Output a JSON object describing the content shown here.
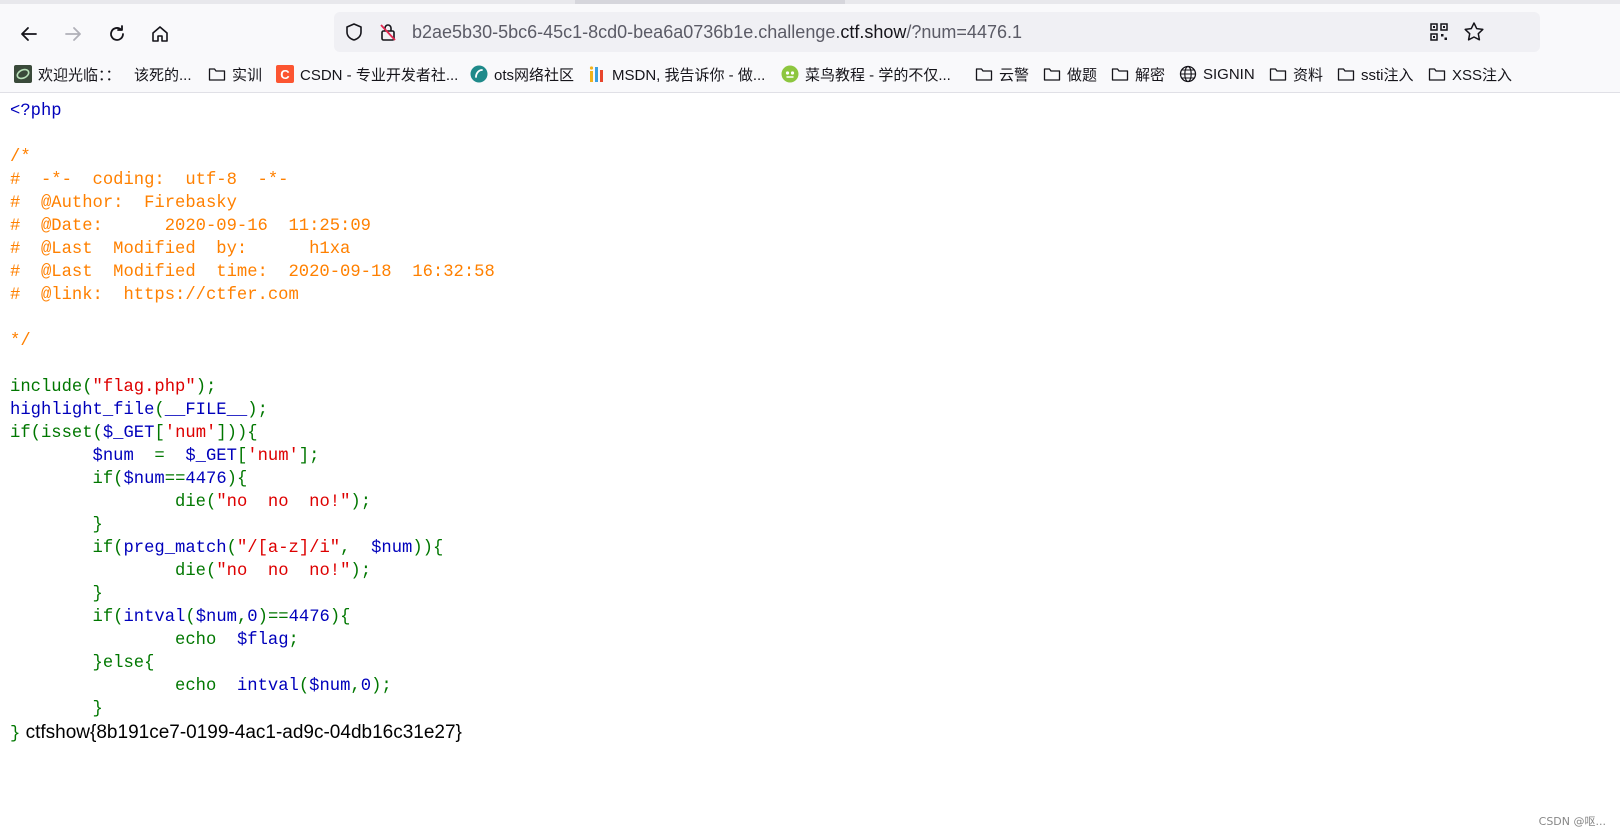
{
  "browser": {
    "url_prefix": "b2ae5b30-5bc6-45c1-8cd0-bea6a0736b1e.challenge.",
    "url_host": "ctf.show",
    "url_suffix": "/?num=4476.1"
  },
  "bookmarks": [
    {
      "icon": "swirl-icon",
      "label": "欢迎光临：："
    },
    {
      "icon": "none",
      "label": "该死的..."
    },
    {
      "icon": "folder-icon",
      "label": "实训"
    },
    {
      "icon": "csdn-icon",
      "label": "CSDN - 专业开发者社..."
    },
    {
      "icon": "ots-icon",
      "label": "ots网络社区"
    },
    {
      "icon": "msdn-icon",
      "label": "MSDN, 我告诉你 - 做..."
    },
    {
      "icon": "runoob-icon",
      "label": "菜鸟教程 - 学的不仅..."
    },
    {
      "icon": "folder-icon",
      "label": "云警"
    },
    {
      "icon": "folder-icon",
      "label": "做题"
    },
    {
      "icon": "folder-icon",
      "label": "解密"
    },
    {
      "icon": "globe-icon",
      "label": "SIGNIN"
    },
    {
      "icon": "folder-icon",
      "label": "资料"
    },
    {
      "icon": "folder-icon",
      "label": "ssti注入"
    },
    {
      "icon": "folder-icon",
      "label": "XSS注入"
    }
  ],
  "code": {
    "open_tag": "<?php",
    "comment_lines": [
      "/*",
      "#  -*-  coding:  utf-8  -*-",
      "#  @Author:  Firebasky",
      "#  @Date:      2020-09-16  11:25:09",
      "#  @Last  Modified  by:      h1xa",
      "#  @Last  Modified  time:  2020-09-18  16:32:58",
      "#  @link:  https://ctfer.com",
      "",
      "*/"
    ],
    "include_fn": "include",
    "include_arg": "\"flag.php\"",
    "highlight_fn": "highlight_file",
    "highlight_arg": "__FILE__",
    "isset_prefix": "isset(",
    "get_var": "$_GET",
    "num_key": "'num'",
    "num_var": "$num",
    "num_literal": "4476",
    "die_fn": "die",
    "die_msg": "\"no  no  no!\"",
    "preg_fn": "preg_match",
    "preg_pattern": "\"/[a-z]/i\"",
    "intval_fn": "intval",
    "zero": "0",
    "echo_kw": "echo",
    "flag_var": "$flag",
    "else_kw": "else",
    "if_kw": "if",
    "output": " ctfshow{8b191ce7-0199-4ac1-ad9c-04db16c31e27}"
  },
  "watermark": "CSDN @呕..."
}
